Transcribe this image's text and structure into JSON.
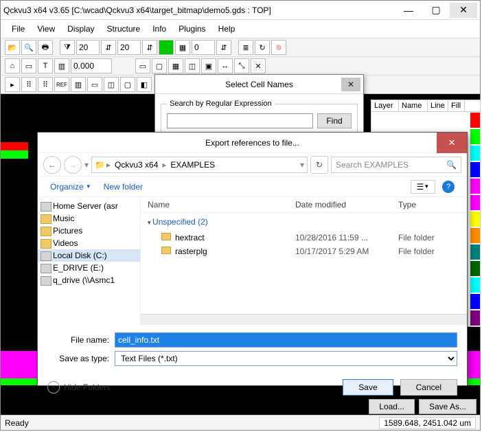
{
  "app": {
    "title": "Qckvu3 x64 v3.65 [C:\\wcad\\Qckvu3 x64\\target_bitmap\\demo5.gds : TOP]",
    "menus": [
      "File",
      "View",
      "Display",
      "Structure",
      "Info",
      "Plugins",
      "Help"
    ],
    "num1": "20",
    "num2": "20",
    "num3": "0",
    "reading": "0.000",
    "status": "Ready",
    "coords": "1589.648, 2451.042 um",
    "load": "Load...",
    "saveas": "Save As..."
  },
  "layerpanel": {
    "hdr": [
      "Layer",
      "Name",
      "Line",
      "Fill"
    ]
  },
  "dlg_cells": {
    "title": "Select Cell Names",
    "group": "Search by Regular Expression",
    "find": "Find"
  },
  "dlg_export": {
    "title": "Export references to file...",
    "crumbs": [
      "Qckvu3 x64",
      "EXAMPLES"
    ],
    "search_ph": "Search EXAMPLES",
    "organize": "Organize",
    "newfolder": "New folder",
    "tree": [
      {
        "label": "Home Server (asr",
        "kind": "drive"
      },
      {
        "label": "Music",
        "kind": "folder"
      },
      {
        "label": "Pictures",
        "kind": "folder"
      },
      {
        "label": "Videos",
        "kind": "folder"
      },
      {
        "label": "Local Disk (C:)",
        "kind": "drive",
        "sel": true
      },
      {
        "label": "E_DRIVE (E:)",
        "kind": "drive"
      },
      {
        "label": "q_drive (\\\\Asmc1",
        "kind": "drive"
      }
    ],
    "cols": {
      "name": "Name",
      "date": "Date modified",
      "type": "Type"
    },
    "group": "Unspecified (2)",
    "rows": [
      {
        "name": "hextract",
        "date": "10/28/2016 11:59 ...",
        "type": "File folder"
      },
      {
        "name": "rasterplg",
        "date": "10/17/2017 5:29 AM",
        "type": "File folder"
      }
    ],
    "filename_label": "File name:",
    "filename": "cell_info.txt",
    "savetype_label": "Save as type:",
    "savetype": "Text Files (*.txt)",
    "hide": "Hide Folders",
    "save": "Save",
    "cancel": "Cancel"
  }
}
